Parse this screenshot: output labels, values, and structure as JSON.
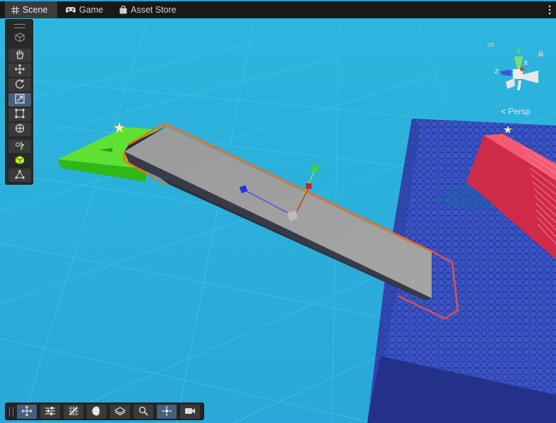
{
  "tabs": [
    {
      "label": "Scene",
      "icon": "grid-icon",
      "active": true
    },
    {
      "label": "Game",
      "icon": "gamepad-icon",
      "active": false
    },
    {
      "label": "Asset Store",
      "icon": "shopping-bag-icon",
      "active": false
    }
  ],
  "viewport": {
    "projection_label": "Persp",
    "gizmo_axes": {
      "y": "y",
      "x": "x",
      "z": "z"
    },
    "colors": {
      "sky": "#2ab3dc",
      "grid": "#3fc1e2",
      "ramp_outline": "#ff6a13",
      "green_platform": "#5ce12f",
      "blue_block": "#3448b0",
      "red_stairs": "#e8445f"
    }
  },
  "tools": [
    {
      "name": "view-tool",
      "icon": "hand-icon"
    },
    {
      "name": "move-tool",
      "icon": "move-arrows-icon"
    },
    {
      "name": "rotate-tool",
      "icon": "rotate-icon"
    },
    {
      "name": "scale-tool",
      "icon": "scale-icon",
      "selected": true
    },
    {
      "name": "rect-tool",
      "icon": "rect-transform-icon"
    },
    {
      "name": "transform-tool",
      "icon": "transform-icon"
    },
    {
      "name": "custom-tool",
      "icon": "pivot-tool-icon"
    },
    {
      "name": "probuilder-tool",
      "icon": "green-cube-icon"
    },
    {
      "name": "vertex-tool",
      "icon": "vertex-icon"
    }
  ],
  "overlay_toolbar": [
    {
      "icon": "move-arrows-icon",
      "selected": true
    },
    {
      "icon": "sliders-icon"
    },
    {
      "icon": "grid-snap-icon"
    },
    {
      "icon": "shading-sphere-icon"
    },
    {
      "icon": "layers-icon"
    },
    {
      "icon": "search-icon"
    },
    {
      "icon": "pivot-center-icon",
      "selected": true
    },
    {
      "icon": "camera-icon"
    }
  ]
}
